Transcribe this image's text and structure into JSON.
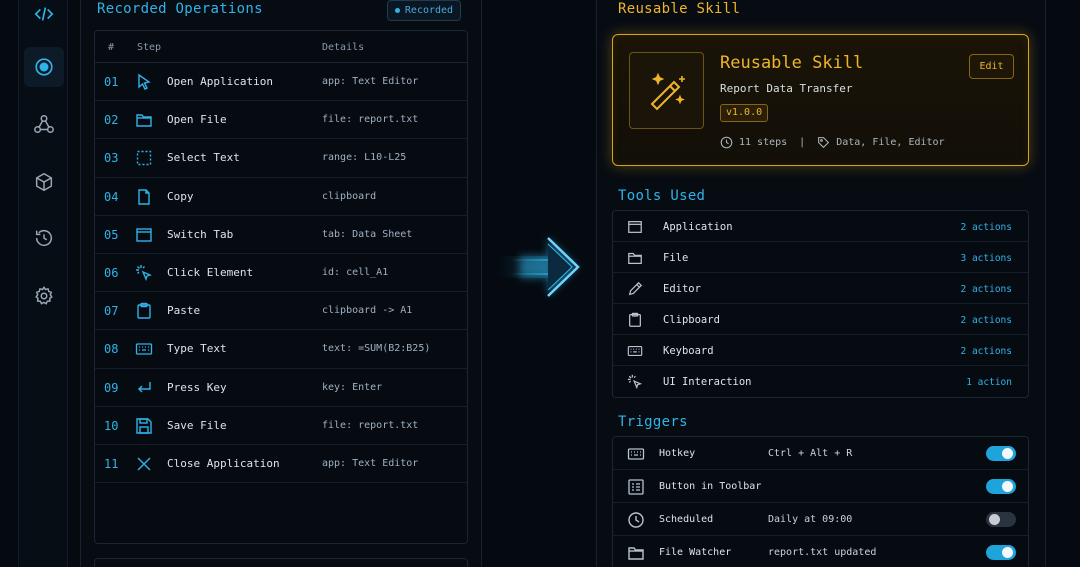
{
  "rail": {
    "icons": [
      "code-icon",
      "record-icon",
      "network-icon",
      "cube-icon",
      "history-icon",
      "settings-icon"
    ],
    "active": "record-icon"
  },
  "recorded": {
    "title": "Recorded Operations",
    "badge": "Recorded",
    "columns": [
      "#",
      "Step",
      "Details"
    ],
    "rows": [
      {
        "num": "01",
        "icon": "cursor-icon",
        "step": "Open Application",
        "details": "app: Text Editor"
      },
      {
        "num": "02",
        "icon": "folder-icon",
        "step": "Open File",
        "details": "file: report.txt"
      },
      {
        "num": "03",
        "icon": "select-icon",
        "step": "Select Text",
        "details": "range: L10-L25"
      },
      {
        "num": "04",
        "icon": "copy-icon",
        "step": "Copy",
        "details": "clipboard"
      },
      {
        "num": "05",
        "icon": "window-icon",
        "step": "Switch Tab",
        "details": "tab: Data Sheet"
      },
      {
        "num": "06",
        "icon": "click-icon",
        "step": "Click Element",
        "details": "id: cell_A1"
      },
      {
        "num": "07",
        "icon": "clipboard-icon",
        "step": "Paste",
        "details": "clipboard -> A1"
      },
      {
        "num": "08",
        "icon": "keyboard-icon",
        "step": "Type Text",
        "details": "text: =SUM(B2:B25)"
      },
      {
        "num": "09",
        "icon": "enter-icon",
        "step": "Press Key",
        "details": "key: Enter"
      },
      {
        "num": "10",
        "icon": "save-icon",
        "step": "Save File",
        "details": "file: report.txt"
      },
      {
        "num": "11",
        "icon": "close-icon",
        "step": "Close Application",
        "details": "app: Text Editor"
      }
    ]
  },
  "skill": {
    "section_title": "Reusable Skill",
    "name": "Reusable Skill",
    "subtitle": "Report Data Transfer",
    "version": "v1.0.0",
    "steps": "11 steps",
    "separator": "|",
    "tags": "Data, File, Editor",
    "edit_label": "Edit"
  },
  "tools": {
    "title": "Tools Used",
    "items": [
      {
        "icon": "window-icon",
        "name": "Application",
        "count": "2 actions"
      },
      {
        "icon": "folder-icon",
        "name": "File",
        "count": "3 actions"
      },
      {
        "icon": "pencil-icon",
        "name": "Editor",
        "count": "2 actions"
      },
      {
        "icon": "clipboard-icon",
        "name": "Clipboard",
        "count": "2 actions"
      },
      {
        "icon": "keyboard-icon",
        "name": "Keyboard",
        "count": "2 actions"
      },
      {
        "icon": "click-icon",
        "name": "UI Interaction",
        "count": "1 action"
      }
    ]
  },
  "triggers": {
    "title": "Triggers",
    "items": [
      {
        "icon": "keyboard-icon",
        "name": "Hotkey",
        "value": "Ctrl + Alt + R",
        "enabled": true
      },
      {
        "icon": "toolbar-icon",
        "name": "Button in Toolbar",
        "value": "",
        "enabled": true
      },
      {
        "icon": "clock-icon",
        "name": "Scheduled",
        "value": "Daily at 09:00",
        "enabled": false
      },
      {
        "icon": "folder-icon",
        "name": "File Watcher",
        "value": "report.txt updated",
        "enabled": true
      }
    ]
  },
  "colors": {
    "accent": "#2fb3e8",
    "gold": "#f0b429",
    "background": "#050a11"
  }
}
